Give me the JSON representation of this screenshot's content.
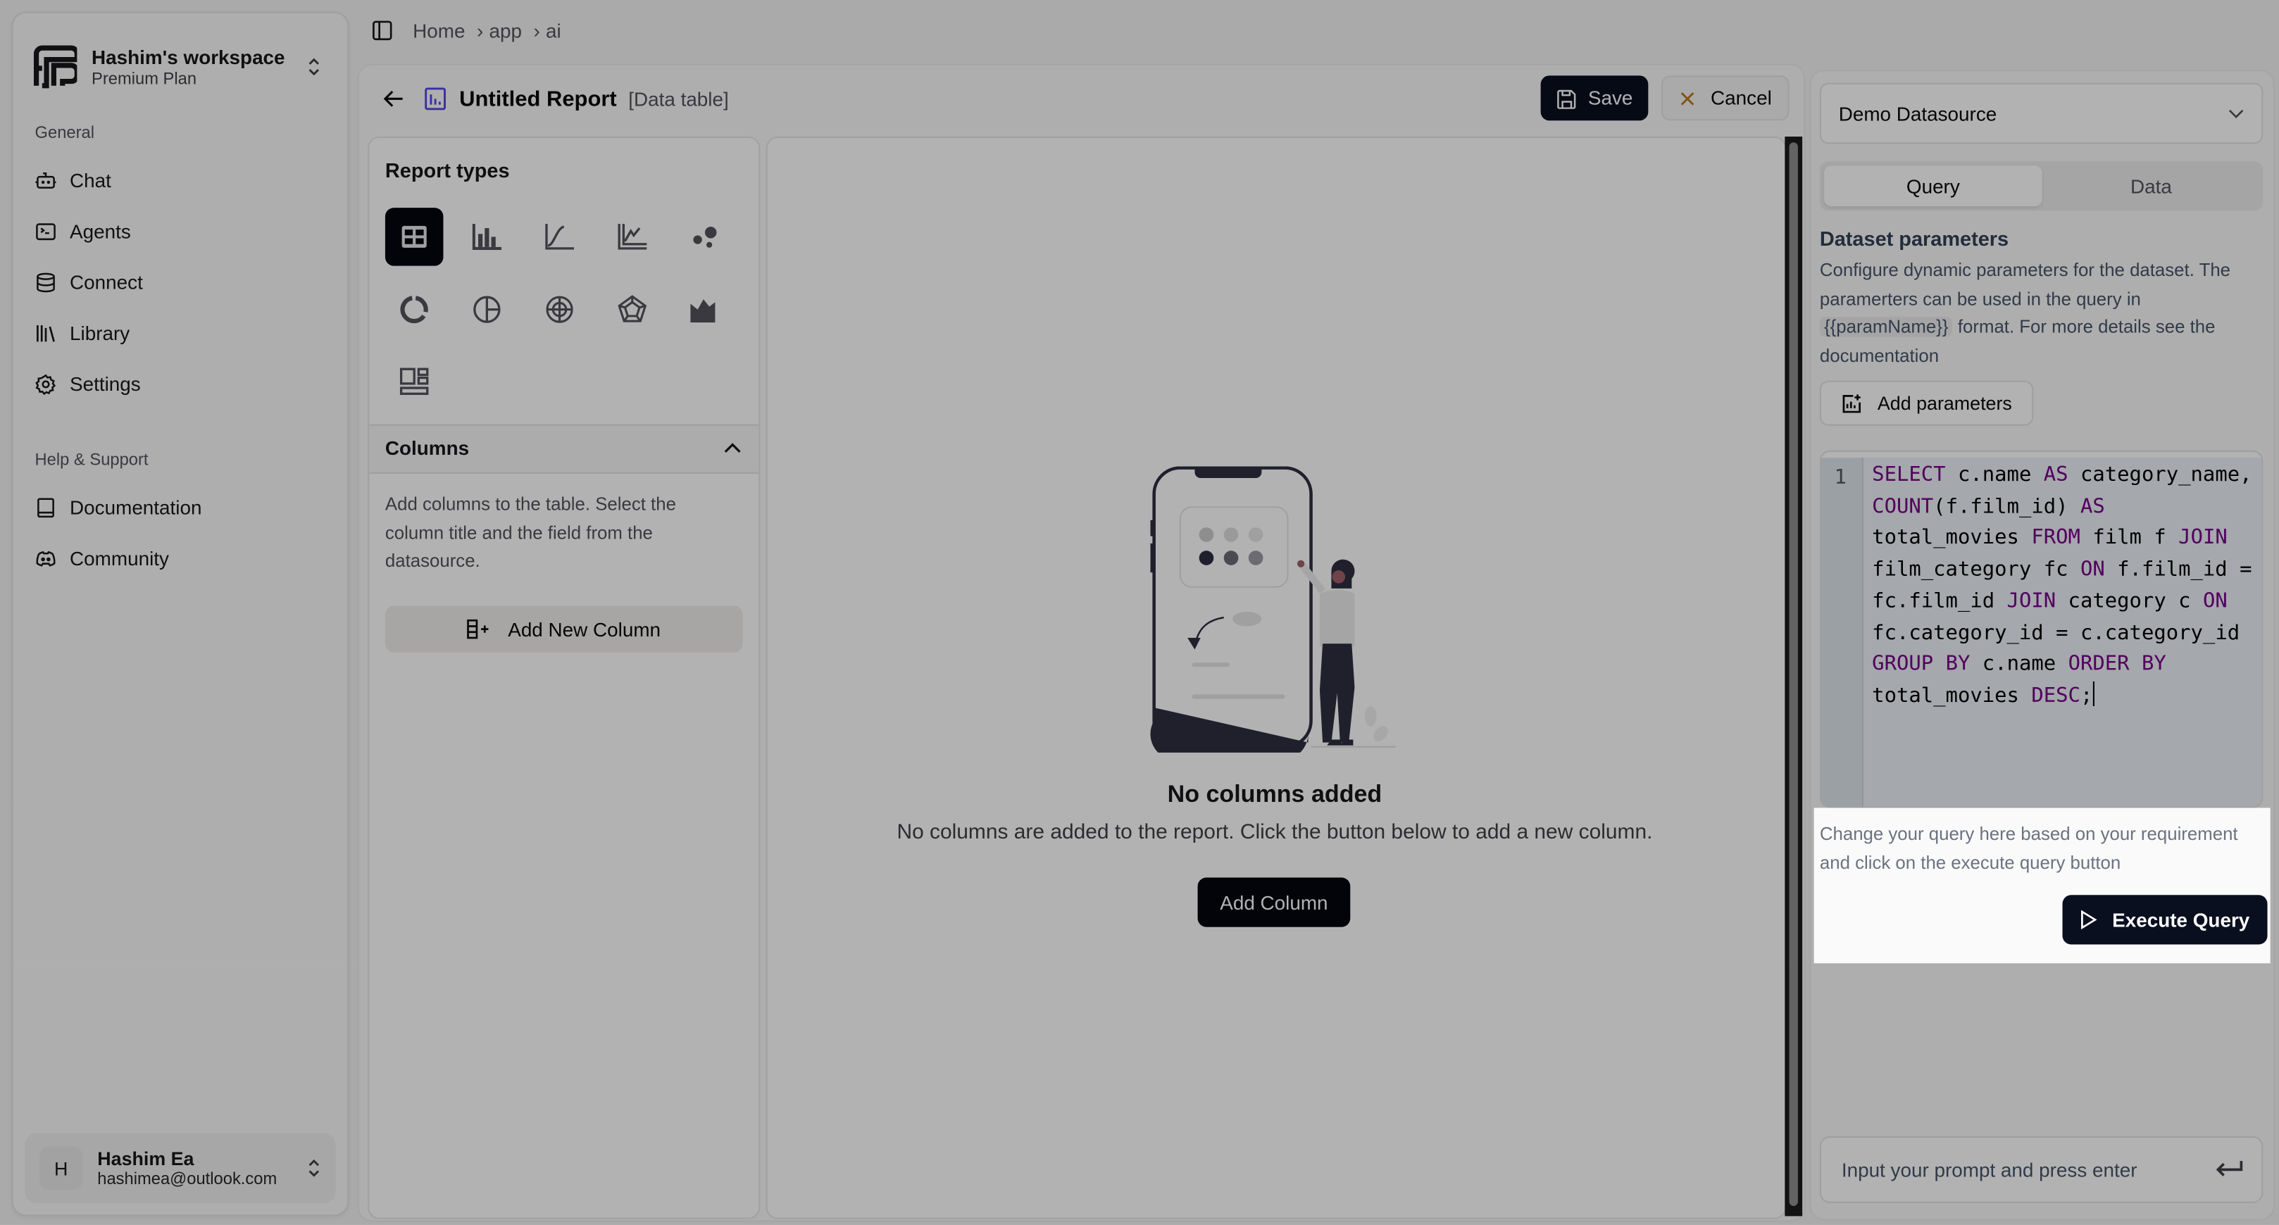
{
  "workspace": {
    "name": "Hashim's workspace",
    "plan": "Premium Plan"
  },
  "sidebar": {
    "groups": [
      {
        "label": "General",
        "items": [
          {
            "label": "Chat",
            "icon": "bot-icon"
          },
          {
            "label": "Agents",
            "icon": "terminal-icon"
          },
          {
            "label": "Connect",
            "icon": "database-icon"
          },
          {
            "label": "Library",
            "icon": "library-icon"
          },
          {
            "label": "Settings",
            "icon": "gear-icon"
          }
        ]
      },
      {
        "label": "Help & Support",
        "items": [
          {
            "label": "Documentation",
            "icon": "book-icon"
          },
          {
            "label": "Community",
            "icon": "discord-icon"
          }
        ]
      }
    ]
  },
  "user": {
    "initial": "H",
    "name": "Hashim Ea",
    "email": "hashimea@outlook.com"
  },
  "breadcrumb": [
    "Home",
    "app",
    "ai"
  ],
  "report": {
    "title": "Untitled Report",
    "type_label": "[Data table]",
    "save_label": "Save",
    "cancel_label": "Cancel"
  },
  "report_types": {
    "title": "Report types",
    "selected": "table",
    "types": [
      {
        "id": "table",
        "icon": "table-icon"
      },
      {
        "id": "bar",
        "icon": "bar-chart-icon"
      },
      {
        "id": "line",
        "icon": "line-chart-icon"
      },
      {
        "id": "multi-line",
        "icon": "multi-line-chart-icon"
      },
      {
        "id": "bubble",
        "icon": "bubble-chart-icon"
      },
      {
        "id": "doughnut",
        "icon": "doughnut-chart-icon"
      },
      {
        "id": "pie",
        "icon": "pie-chart-icon"
      },
      {
        "id": "polar",
        "icon": "polar-chart-icon"
      },
      {
        "id": "radar",
        "icon": "radar-chart-icon"
      },
      {
        "id": "area",
        "icon": "area-chart-icon"
      },
      {
        "id": "card",
        "icon": "dashboard-layout-icon"
      }
    ]
  },
  "columns": {
    "title": "Columns",
    "description": "Add columns to the table. Select the column title and the field from the datasource.",
    "add_button": "Add New Column"
  },
  "empty_state": {
    "title": "No columns added",
    "description": "No columns are added to the report. Click the button below to add a new column.",
    "button": "Add Column"
  },
  "right_panel": {
    "datasource": "Demo Datasource",
    "tabs": [
      {
        "label": "Query",
        "active": true
      },
      {
        "label": "Data",
        "active": false
      }
    ],
    "dataset_params": {
      "title": "Dataset parameters",
      "desc_before": "Configure dynamic parameters for the dataset. The paramerters can be used in the query in ",
      "code": "{{paramName}}",
      "desc_after": " format. For more details see the documentation",
      "add_button": "Add parameters"
    },
    "editor": {
      "line_number": "1",
      "query": "SELECT c.name AS category_name, COUNT(f.film_id) AS total_movies FROM film f JOIN film_category fc ON f.film_id = fc.film_id JOIN category c ON fc.category_id = c.category_id GROUP BY c.name ORDER BY total_movies DESC;",
      "keywords": [
        "SELECT",
        "AS",
        "COUNT",
        "FROM",
        "JOIN",
        "ON",
        "GROUP",
        "BY",
        "ORDER",
        "DESC"
      ]
    },
    "hint": "Change your query here based on your requirement and click on the execute query button",
    "execute_button": "Execute Query",
    "prompt_placeholder": "Input your prompt and press enter"
  },
  "colors": {
    "primary": "#0a0f1f",
    "keyword": "#770088",
    "report_icon": "#4f46e5",
    "cancel_icon": "#b7791f"
  }
}
